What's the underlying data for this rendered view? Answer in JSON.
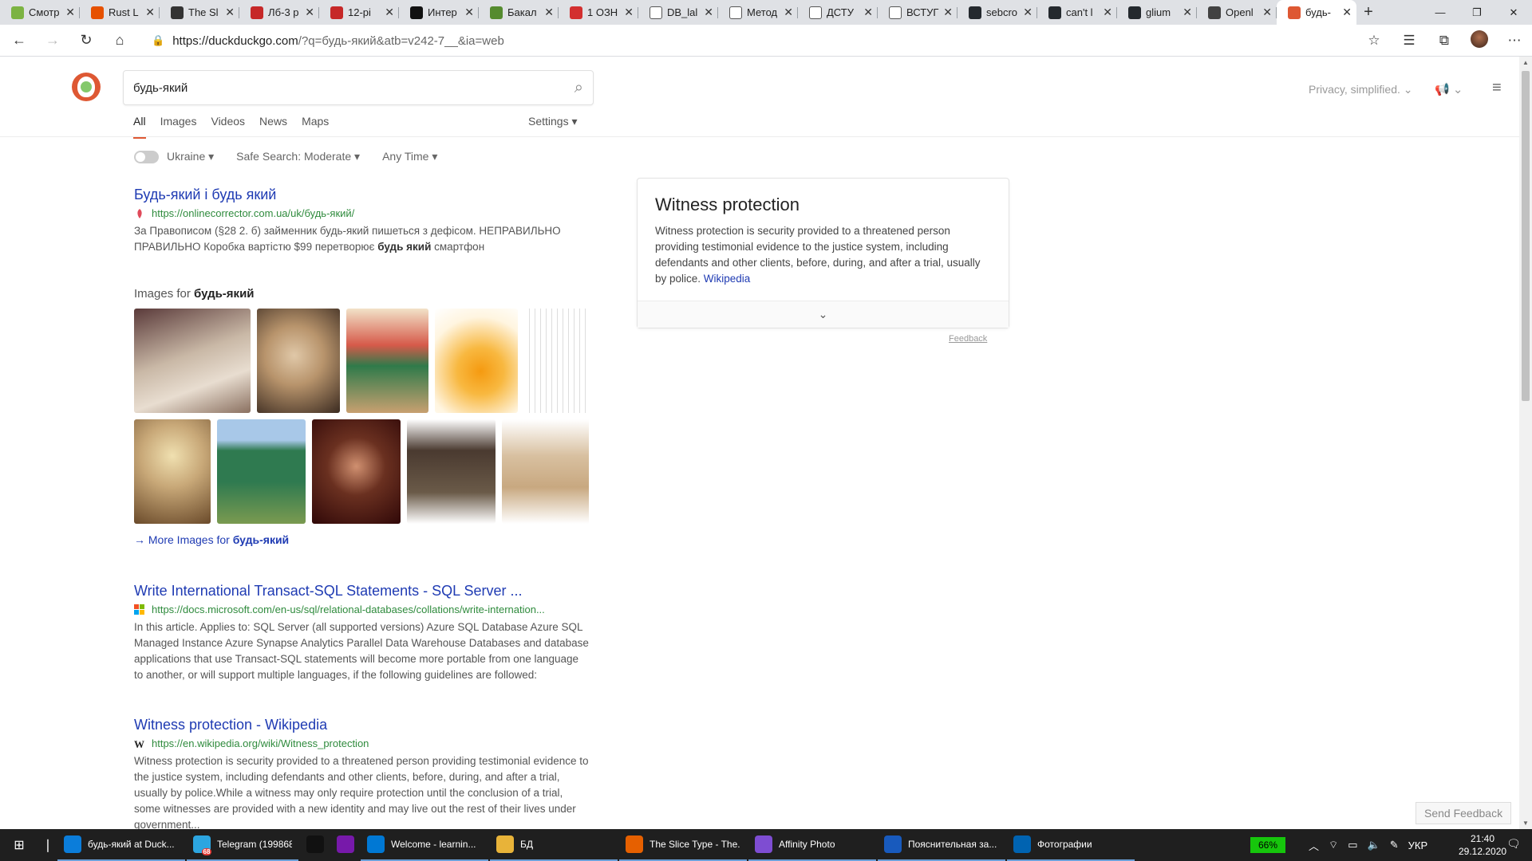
{
  "browser": {
    "tabs": [
      {
        "title": "Смотр",
        "color": "#7cb342"
      },
      {
        "title": "Rust L",
        "color": "#e65100"
      },
      {
        "title": "The Sl",
        "color": "#333333"
      },
      {
        "title": "Лб-3 р",
        "color": "#c62828"
      },
      {
        "title": "12-рі",
        "color": "#c62828"
      },
      {
        "title": "Интер",
        "color": "#111111"
      },
      {
        "title": "Бакал",
        "color": "#558b2f"
      },
      {
        "title": "1 ОЗН",
        "color": "#d32f2f"
      },
      {
        "title": "DB_lal",
        "color": "#ffffff"
      },
      {
        "title": "Метод",
        "color": "#ffffff"
      },
      {
        "title": "ДСТУ",
        "color": "#ffffff"
      },
      {
        "title": "ВСТУГ",
        "color": "#ffffff"
      },
      {
        "title": "sebcro",
        "color": "#24292e"
      },
      {
        "title": "can't l",
        "color": "#24292e"
      },
      {
        "title": "glium",
        "color": "#24292e"
      },
      {
        "title": "Openl",
        "color": "#424242"
      },
      {
        "title": "будь-",
        "color": "#de5833"
      }
    ],
    "url_host": "https://duckduckgo.com",
    "url_path": "/?q=будь-який&atb=v242-7__&ia=web"
  },
  "ddg": {
    "query": "будь-який",
    "nav": [
      "All",
      "Images",
      "Videos",
      "News",
      "Maps"
    ],
    "settings": "Settings",
    "privacy": "Privacy, simplified.",
    "filters": {
      "region": "Ukraine",
      "safe_search": "Safe Search: Moderate",
      "time": "Any Time"
    }
  },
  "results": [
    {
      "title": "Будь-який і будь який",
      "url": "https://onlinecorrector.com.ua/uk/будь-який/",
      "snippet_pre": "За Правописом (§28 2. б) займенник будь-який пишеться з дефісом. НЕПРАВИЛЬНО ПРАВИЛЬНО Коробка вартістю $99 перетворює ",
      "snippet_bold": "будь який",
      "snippet_post": " смартфон"
    },
    {
      "title": "Write International Transact-SQL Statements - SQL Server ...",
      "url": "https://docs.microsoft.com/en-us/sql/relational-databases/collations/write-internation...",
      "snippet": "In this article. Applies to: SQL Server (all supported versions) Azure SQL Database Azure SQL Managed Instance Azure Synapse Analytics Parallel Data Warehouse Databases and database applications that use Transact-SQL statements will become more portable from one language to another, or will support multiple languages, if the following guidelines are followed:"
    },
    {
      "title": "Witness protection - Wikipedia",
      "url": "https://en.wikipedia.org/wiki/Witness_protection",
      "snippet": "Witness protection is security provided to a threatened person providing testimonial evidence to the justice system, including defendants and other clients, before, during, and after a trial, usually by police.While a witness may only require protection until the conclusion of a trial, some witnesses are provided with a new identity and may live out the rest of their lives under government..."
    }
  ],
  "images": {
    "heading": "Images for ",
    "heading_bold": "будь-який",
    "more_prefix": "More Images for ",
    "more_bold": "будь-який"
  },
  "infobox": {
    "title": "Witness protection",
    "text": "Witness protection is security provided to a threatened person providing testimonial evidence to the justice system, including defendants and other clients, before, during, and after a trial, usually by police. ",
    "link": "Wikipedia",
    "feedback": "Feedback"
  },
  "send_feedback": "Send Feedback",
  "taskbar": {
    "items": [
      {
        "label": "будь-який at Duck...",
        "color": "#0b7dda"
      },
      {
        "label": "Telegram (199868)",
        "color": "#2ca5e0"
      },
      {
        "label": "",
        "color": "#111111"
      },
      {
        "label": "",
        "color": "#7719aa"
      },
      {
        "label": "Welcome - learnin...",
        "color": "#0078d4"
      },
      {
        "label": "БД",
        "color": "#e8b339"
      },
      {
        "label": "The Slice Type - The...",
        "color": "#e66000"
      },
      {
        "label": "Affinity Photo",
        "color": "#7e4dd2"
      },
      {
        "label": "Пояснительная за...",
        "color": "#185abd"
      },
      {
        "label": "Фотографии",
        "color": "#0063b1"
      }
    ],
    "telegram_badge": "68",
    "battery": "66%",
    "lang": "УКР",
    "time": "21:40",
    "date": "29.12.2020"
  }
}
